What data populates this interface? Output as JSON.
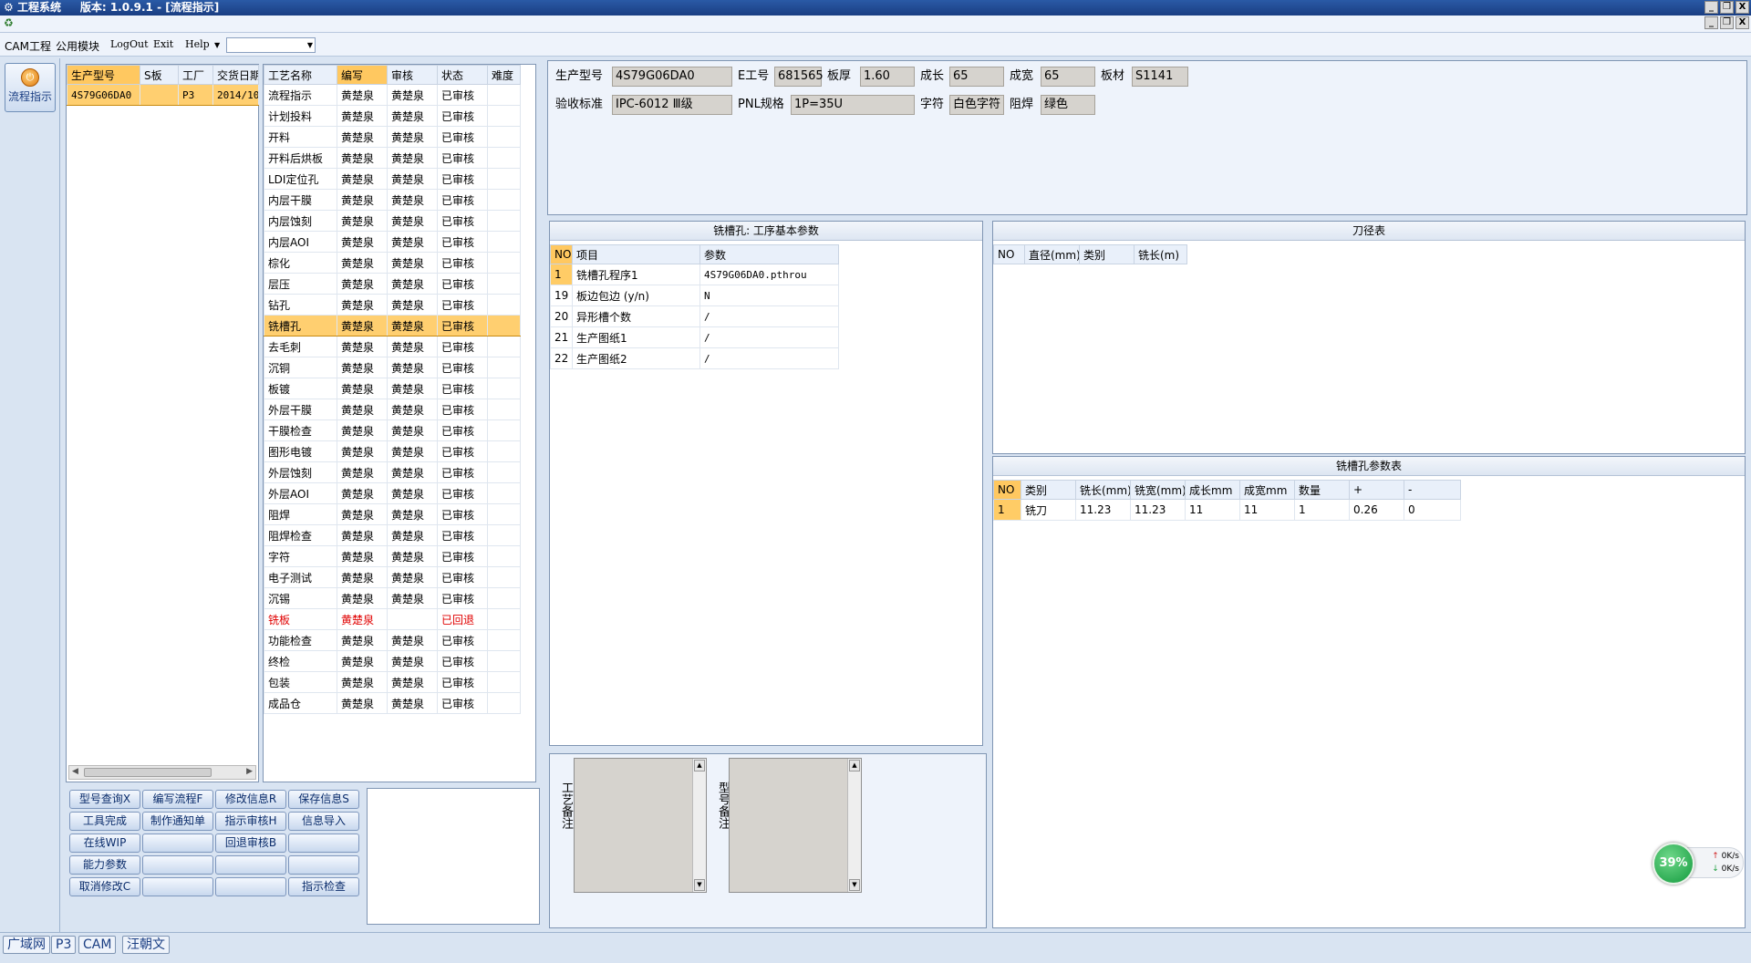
{
  "window": {
    "app_title": "工程系统",
    "version": "版本: 1.0.9.1 - [流程指示]",
    "min": "_",
    "restore": "❐",
    "close": "X"
  },
  "menu": {
    "items": [
      "CAM工程",
      "公用模块",
      "LogOut",
      "Exit",
      "Help"
    ],
    "combo_value": ""
  },
  "nav": {
    "label": "流程指示"
  },
  "model_list": {
    "columns": [
      "生产型号",
      "S板",
      "工厂",
      "交货日期"
    ],
    "rows": [
      [
        "4S79G06DA0",
        "",
        "P3",
        "2014/10"
      ]
    ]
  },
  "process_list": {
    "columns": [
      "工艺名称",
      "编写",
      "审核",
      "状态",
      "难度"
    ],
    "rows": [
      [
        "流程指示",
        "黄楚泉",
        "黄楚泉",
        "已审核",
        ""
      ],
      [
        "计划投料",
        "黄楚泉",
        "黄楚泉",
        "已审核",
        ""
      ],
      [
        "开料",
        "黄楚泉",
        "黄楚泉",
        "已审核",
        ""
      ],
      [
        "开料后烘板",
        "黄楚泉",
        "黄楚泉",
        "已审核",
        ""
      ],
      [
        "LDI定位孔",
        "黄楚泉",
        "黄楚泉",
        "已审核",
        ""
      ],
      [
        "内层干膜",
        "黄楚泉",
        "黄楚泉",
        "已审核",
        ""
      ],
      [
        "内层蚀刻",
        "黄楚泉",
        "黄楚泉",
        "已审核",
        ""
      ],
      [
        "内层AOI",
        "黄楚泉",
        "黄楚泉",
        "已审核",
        ""
      ],
      [
        "棕化",
        "黄楚泉",
        "黄楚泉",
        "已审核",
        ""
      ],
      [
        "层压",
        "黄楚泉",
        "黄楚泉",
        "已审核",
        ""
      ],
      [
        "钻孔",
        "黄楚泉",
        "黄楚泉",
        "已审核",
        ""
      ],
      [
        "铣槽孔",
        "黄楚泉",
        "黄楚泉",
        "已审核",
        ""
      ],
      [
        "去毛刺",
        "黄楚泉",
        "黄楚泉",
        "已审核",
        ""
      ],
      [
        "沉铜",
        "黄楚泉",
        "黄楚泉",
        "已审核",
        ""
      ],
      [
        "板镀",
        "黄楚泉",
        "黄楚泉",
        "已审核",
        ""
      ],
      [
        "外层干膜",
        "黄楚泉",
        "黄楚泉",
        "已审核",
        ""
      ],
      [
        "干膜检查",
        "黄楚泉",
        "黄楚泉",
        "已审核",
        ""
      ],
      [
        "图形电镀",
        "黄楚泉",
        "黄楚泉",
        "已审核",
        ""
      ],
      [
        "外层蚀刻",
        "黄楚泉",
        "黄楚泉",
        "已审核",
        ""
      ],
      [
        "外层AOI",
        "黄楚泉",
        "黄楚泉",
        "已审核",
        ""
      ],
      [
        "阻焊",
        "黄楚泉",
        "黄楚泉",
        "已审核",
        ""
      ],
      [
        "阻焊检查",
        "黄楚泉",
        "黄楚泉",
        "已审核",
        ""
      ],
      [
        "字符",
        "黄楚泉",
        "黄楚泉",
        "已审核",
        ""
      ],
      [
        "电子测试",
        "黄楚泉",
        "黄楚泉",
        "已审核",
        ""
      ],
      [
        "沉锡",
        "黄楚泉",
        "黄楚泉",
        "已审核",
        ""
      ],
      [
        "铣板",
        "黄楚泉",
        "",
        "已回退",
        ""
      ],
      [
        "功能检查",
        "黄楚泉",
        "黄楚泉",
        "已审核",
        ""
      ],
      [
        "终检",
        "黄楚泉",
        "黄楚泉",
        "已审核",
        ""
      ],
      [
        "包装",
        "黄楚泉",
        "黄楚泉",
        "已审核",
        ""
      ],
      [
        "成品仓",
        "黄楚泉",
        "黄楚泉",
        "已审核",
        ""
      ]
    ],
    "selected_index": 11,
    "returned_index": 25
  },
  "buttons": [
    [
      "型号查询X",
      "编写流程F",
      "修改信息R",
      "保存信息S"
    ],
    [
      "工具完成",
      "制作通知单",
      "指示审核H",
      "信息导入"
    ],
    [
      "在线WIP",
      "",
      "回退审核B",
      ""
    ],
    [
      "能力参数",
      "",
      "",
      ""
    ],
    [
      "取消修改C",
      "",
      "",
      "指示检查"
    ]
  ],
  "header": {
    "model_label": "生产型号",
    "model_value": "4S79G06DA0",
    "eno_label": "E工号",
    "eno_value": "681565",
    "thick_label": "板厚",
    "thick_value": "1.60",
    "len_label": "成长",
    "len_value": "65",
    "wid_label": "成宽",
    "wid_value": "65",
    "mat_label": "板材",
    "mat_value": "S1141",
    "std_label": "验收标准",
    "std_value": "IPC-6012 Ⅲ级",
    "pnl_label": "PNL规格",
    "pnl_value": "1P=35U",
    "char_label": "字符",
    "char_value": "白色字符",
    "mask_label": "阻焊",
    "mask_value": "绿色"
  },
  "params": {
    "title": "铣槽孔: 工序基本参数",
    "columns": [
      "NO",
      "项目",
      "参数"
    ],
    "rows": [
      [
        "1",
        "铣槽孔程序1",
        "4S79G06DA0.pthrou"
      ],
      [
        "19",
        "板边包边 (y/n)",
        "N"
      ],
      [
        "20",
        "异形槽个数",
        "/"
      ],
      [
        "21",
        "生产图纸1",
        "/"
      ],
      [
        "22",
        "生产图纸2",
        "/"
      ]
    ]
  },
  "tools": {
    "title": "刀径表",
    "columns": [
      "NO",
      "直径(mm)",
      "类别",
      "铣长(m)"
    ]
  },
  "slot": {
    "title": "铣槽孔参数表",
    "columns": [
      "NO",
      "类别",
      "铣长(mm)",
      "铣宽(mm)",
      "成长mm",
      "成宽mm",
      "数量",
      "+",
      "-"
    ],
    "rows": [
      [
        "1",
        "铣刀",
        "11.23",
        "11.23",
        "11",
        "11",
        "1",
        "0.26",
        "0"
      ]
    ]
  },
  "notes": {
    "process_label": "工艺备注",
    "model_label": "型号备注"
  },
  "status_tabs": [
    "广域网",
    "P3",
    "CAM",
    "汪朝文"
  ],
  "net": {
    "percent": "39%",
    "up": "0K/s",
    "down": "0K/s",
    "up_arrow": "↑",
    "down_arrow": "↓"
  }
}
